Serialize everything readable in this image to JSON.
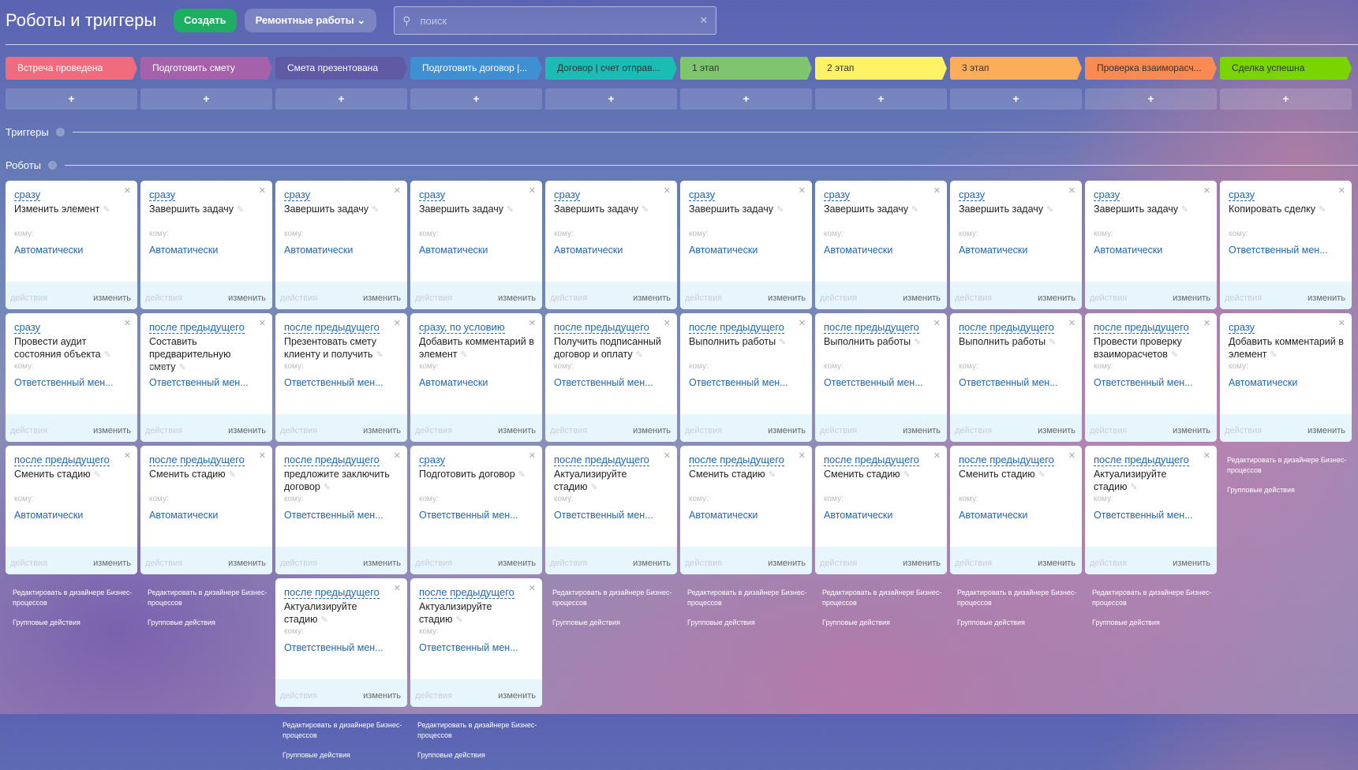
{
  "header": {
    "title": "Роботы и триггеры",
    "create_label": "Создать",
    "category_label": "Ремонтные работы",
    "search_placeholder": "поиск"
  },
  "sections": {
    "triggers": "Триггеры",
    "robots": "Роботы"
  },
  "labels": {
    "to": "кому:",
    "actions": "действия",
    "change": "изменить",
    "designer": "Редактировать в дизайнере Бизнес-процессов",
    "group": "Групповые действия",
    "plus": "+"
  },
  "columns": [
    {
      "stage": "Встреча проведена",
      "color": "#f06b7e",
      "robots": [
        {
          "delay": "сразу",
          "name": "Изменить элемент",
          "resp": "Автоматически"
        },
        {
          "delay": "сразу",
          "name": "Провести аудит состояния объекта",
          "resp": "Ответственный мен..."
        },
        {
          "delay": "после предыдущего",
          "name": "Сменить стадию",
          "resp": "Автоматически"
        }
      ]
    },
    {
      "stage": "Подготовить смету",
      "color": "#a561a9",
      "robots": [
        {
          "delay": "сразу",
          "name": "Завершить задачу",
          "resp": "Автоматически"
        },
        {
          "delay": "после предыдущего",
          "name": "Составить предварительную смету",
          "resp": "Ответственный мен..."
        },
        {
          "delay": "после предыдущего",
          "name": "Сменить стадию",
          "resp": "Автоматически"
        }
      ]
    },
    {
      "stage": "Смета презентована",
      "color": "#605aa4",
      "robots": [
        {
          "delay": "сразу",
          "name": "Завершить задачу",
          "resp": "Автоматически"
        },
        {
          "delay": "после предыдущего",
          "name": "Презентовать смету клиенту и получить",
          "resp": "Ответственный мен..."
        },
        {
          "delay": "после предыдущего",
          "name": "предложите заключить договор",
          "resp": "Ответственный мен..."
        },
        {
          "delay": "после предыдущего",
          "name": "Актуализируйте стадию",
          "resp": "Ответственный мен..."
        }
      ]
    },
    {
      "stage": "Подготовить договор |...",
      "color": "#3f8fd3",
      "robots": [
        {
          "delay": "сразу",
          "name": "Завершить задачу",
          "resp": "Автоматически"
        },
        {
          "delay": "сразу, по условию",
          "name": "Добавить комментарий в элемент",
          "resp": "Автоматически"
        },
        {
          "delay": "сразу",
          "name": "Подготовить договор",
          "resp": "Ответственный мен..."
        },
        {
          "delay": "после предыдущего",
          "name": "Актуализируйте стадию",
          "resp": "Ответственный мен..."
        }
      ]
    },
    {
      "stage": "Договор | счет отправ...",
      "color": "#1bbcb4",
      "dark": true,
      "robots": [
        {
          "delay": "сразу",
          "name": "Завершить задачу",
          "resp": "Автоматически"
        },
        {
          "delay": "после предыдущего",
          "name": "Получить подписанный договор и оплату",
          "resp": "Ответственный мен..."
        },
        {
          "delay": "после предыдущего",
          "name": "Актуализируйте стадию",
          "resp": "Ответственный мен..."
        }
      ]
    },
    {
      "stage": "1 этап",
      "color": "#7ec56e",
      "dark": true,
      "robots": [
        {
          "delay": "сразу",
          "name": "Завершить задачу",
          "resp": "Автоматически"
        },
        {
          "delay": "после предыдущего",
          "name": "Выполнить работы",
          "resp": "Ответственный мен..."
        },
        {
          "delay": "после предыдущего",
          "name": "Сменить стадию",
          "resp": "Автоматически"
        }
      ]
    },
    {
      "stage": "2 этап",
      "color": "#fef265",
      "dark": true,
      "robots": [
        {
          "delay": "сразу",
          "name": "Завершить задачу",
          "resp": "Автоматически"
        },
        {
          "delay": "после предыдущего",
          "name": "Выполнить работы",
          "resp": "Ответственный мен..."
        },
        {
          "delay": "после предыдущего",
          "name": "Сменить стадию",
          "resp": "Автоматически"
        }
      ]
    },
    {
      "stage": "3 этап",
      "color": "#fbad5a",
      "dark": true,
      "robots": [
        {
          "delay": "сразу",
          "name": "Завершить задачу",
          "resp": "Автоматически"
        },
        {
          "delay": "после предыдущего",
          "name": "Выполнить работы",
          "resp": "Ответственный мен..."
        },
        {
          "delay": "после предыдущего",
          "name": "Сменить стадию",
          "resp": "Автоматически"
        }
      ]
    },
    {
      "stage": "Проверка взаиморасч...",
      "color": "#f78b53",
      "dark": true,
      "robots": [
        {
          "delay": "сразу",
          "name": "Завершить задачу",
          "resp": "Автоматически"
        },
        {
          "delay": "после предыдущего",
          "name": "Провести проверку взаиморасчетов",
          "resp": "Ответственный мен..."
        },
        {
          "delay": "после предыдущего",
          "name": "Актуализируйте стадию",
          "resp": "Ответственный мен..."
        }
      ]
    },
    {
      "stage": "Сделка успешна",
      "color": "#79d400",
      "dark": true,
      "robots": [
        {
          "delay": "сразу",
          "name": "Копировать сделку",
          "resp": "Ответственный мен..."
        },
        {
          "delay": "сразу",
          "name": "Добавить комментарий в элемент",
          "resp": "Автоматически"
        }
      ]
    }
  ]
}
